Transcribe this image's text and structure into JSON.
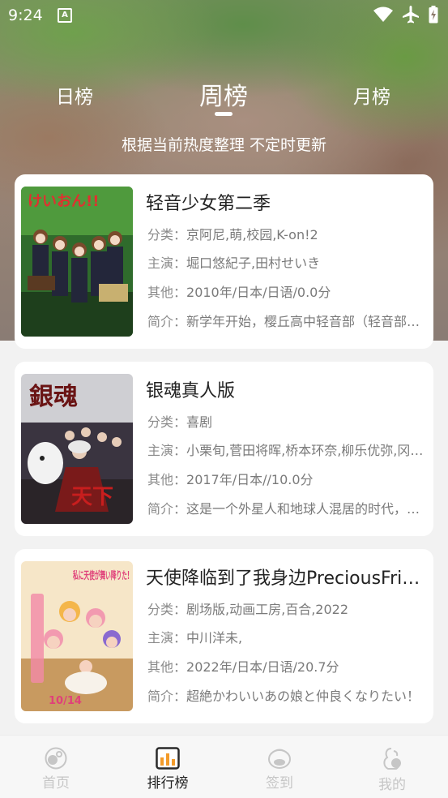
{
  "status": {
    "time": "9:24",
    "badge": "A"
  },
  "tabs": {
    "day": "日榜",
    "week": "周榜",
    "month": "月榜",
    "selected": "周榜"
  },
  "subtitle": "根据当前热度整理 不定时更新",
  "items": [
    {
      "title": "轻音少女第二季",
      "category_label": "分类：",
      "category": "京阿尼,萌,校园,K-on!2",
      "cast_label": "主演：",
      "cast": "堀口悠紀子,田村せいき",
      "other_label": "其他：",
      "other": "2010年/日本/日语/0.0分",
      "intro_label": "简介：",
      "intro": "新学年开始，樱丘高中轻音部（轻音部全员都是高三学生...",
      "poster_text": "けいおん!!"
    },
    {
      "title": "银魂真人版",
      "category_label": "分类：",
      "category": "喜剧",
      "cast_label": "主演：",
      "cast": "小栗旬,菅田将晖,桥本环奈,柳乐优弥,冈田将生",
      "other_label": "其他：",
      "other": "2017年/日本//10.0分",
      "intro_label": "简介：",
      "intro": "这是一个外星人和地球人混居的时代，武士道已经没落...",
      "poster_text": "銀魂"
    },
    {
      "title": "天使降临到了我身边PreciousFriends",
      "category_label": "分类：",
      "category": "剧场版,动画工房,百合,2022",
      "cast_label": "主演：",
      "cast": "中川洋未,",
      "other_label": "其他：",
      "other": "2022年/日本/日语/20.7分",
      "intro_label": "简介：",
      "intro": "超絶かわいいあの娘と仲良くなりたい！",
      "poster_text": "私に天使が舞い降りた!"
    }
  ],
  "bottom_nav": [
    {
      "label": "首页",
      "icon": "home-icon",
      "active": false
    },
    {
      "label": "排行榜",
      "icon": "ranking-icon",
      "active": true
    },
    {
      "label": "签到",
      "icon": "checkin-icon",
      "active": false
    },
    {
      "label": "我的",
      "icon": "profile-icon",
      "active": false
    }
  ],
  "colors": {
    "active_nav": "#222222",
    "inactive_nav": "#c6c6c6",
    "card_bg": "#ffffff",
    "rank_icon_accent": "#f39b2a"
  }
}
